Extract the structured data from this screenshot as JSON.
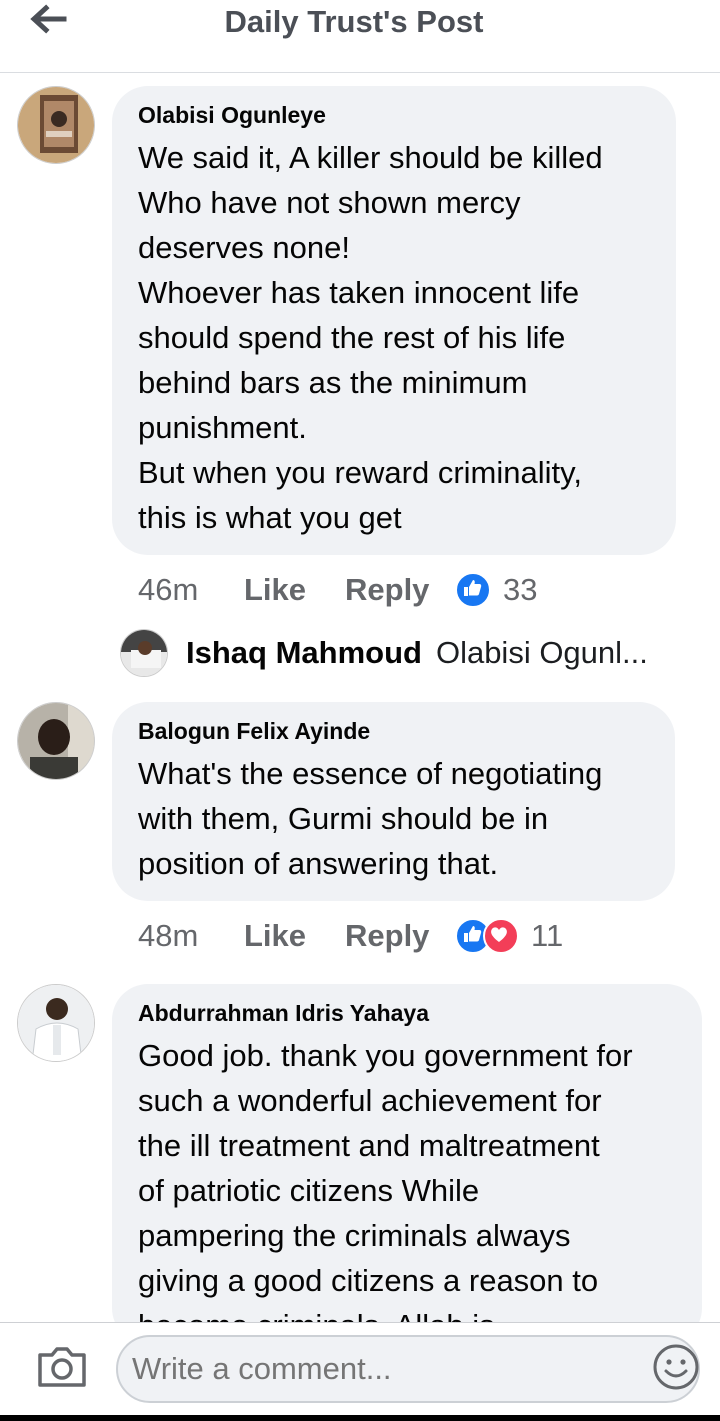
{
  "header": {
    "title": "Daily Trust's Post"
  },
  "comments": [
    {
      "author": "Olabisi Ogunleye",
      "lines": [
        "We said it, A killer should be killed",
        "Who have not shown mercy",
        "deserves none!",
        "Whoever has taken innocent life",
        "should spend the rest of his life",
        "behind bars as the minimum",
        "punishment.",
        "But when you reward criminality,",
        "this is what you get"
      ],
      "time": "46m",
      "like_label": "Like",
      "reply_label": "Reply",
      "reaction_count": "33"
    },
    {
      "author": "Balogun Felix Ayinde",
      "lines": [
        "What's the essence of negotiating",
        "with them, Gurmi should be in",
        "position of answering that."
      ],
      "time": "48m",
      "like_label": "Like",
      "reply_label": "Reply",
      "reaction_count": "11"
    },
    {
      "author": "Abdurrahman Idris Yahaya",
      "lines": [
        "Good job. thank you government for",
        "such a wonderful achievement for",
        "the ill treatment and maltreatment",
        "of patriotic citizens While",
        "pampering the criminals always",
        "giving a good  citizens  a reason to",
        "become criminals. Allah is"
      ]
    }
  ],
  "reply_preview": {
    "name": "Ishaq Mahmoud",
    "text": "Olabisi Ogunl..."
  },
  "composer": {
    "placeholder": "Write a comment..."
  },
  "colors": {
    "like_blue": "#1877f2",
    "love_red": "#f33e58",
    "bubble": "#f0f2f5",
    "meta_grey": "#65676b"
  }
}
